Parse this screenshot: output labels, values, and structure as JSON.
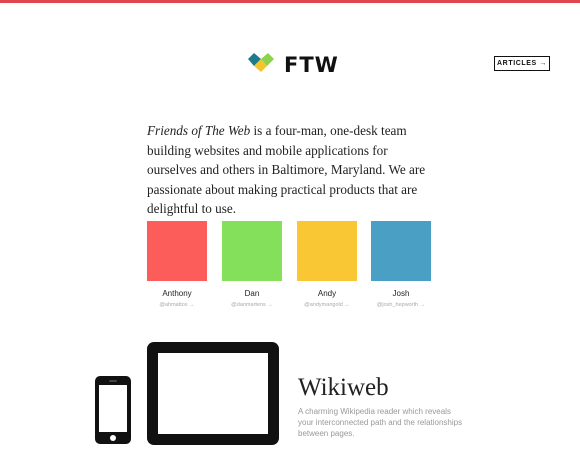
{
  "colors": {
    "accent_bar": "#e0464f",
    "logo_green": "#8cd24a",
    "logo_blue": "#2c9fc0",
    "logo_yellow": "#f5c52e",
    "logo_teal": "#1e7b8a"
  },
  "header": {
    "logo_text": "FTW",
    "articles_label": "ARTICLES →"
  },
  "intro": {
    "name": "Friends of The Web",
    "text": " is a four-man, one-desk team building websites and mobile applications for ourselves and others in Baltimore, Maryland. We are passionate about making practical products that are delightful to use."
  },
  "team": [
    {
      "name": "Anthony",
      "handle": "@ahmattox →",
      "color": "#fd5d5a"
    },
    {
      "name": "Dan",
      "handle": "@danmartens →",
      "color": "#84e05a"
    },
    {
      "name": "Andy",
      "handle": "@andymangold →",
      "color": "#f9c733"
    },
    {
      "name": "Josh",
      "handle": "@josh_hepworth →",
      "color": "#4aa0c4"
    }
  ],
  "project": {
    "title": "Wikiweb",
    "description": "A charming Wikipedia reader which reveals your interconnected path and the relationships between pages."
  }
}
